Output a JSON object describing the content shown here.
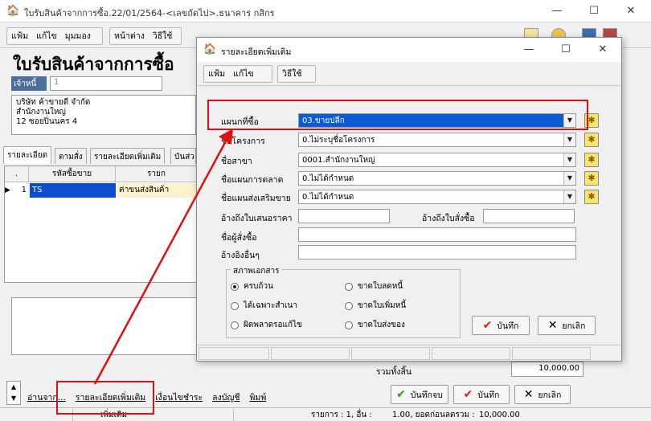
{
  "main_window": {
    "title": "ใบรับสินค้าจากการซื้อ.22/01/2564-<เลขถัดไป>.ธนาคาร กสิกร",
    "menu_left": [
      "แฟ้ม",
      "แก้ไข",
      "มุมมอง"
    ],
    "menu_right": [
      "หน้าต่าง",
      "วิธีใช้"
    ],
    "page_title": "ใบรับสินค้าจากการซื้อ",
    "vendor_label": "เจ้าหนี้",
    "vendor_code": "1",
    "vendor_address": [
      "บริษัท ค้าขายดี จำกัด",
      "สำนักงานใหญ่",
      "12 ซอยปิ่นนคร 4"
    ],
    "tabs": [
      "รายละเอียด",
      "ตามสั่ง",
      "รายละเอียดเพิ่มเติม",
      "บันส่ว"
    ],
    "grid": {
      "headers": [
        ".",
        "รหัสซื้อขาย",
        "รายก"
      ],
      "row": {
        "no": "1",
        "code": "TS",
        "desc": "ค่าขนส่งสินค้า"
      }
    },
    "grand_total_label": "รวมทั้งสิ้น",
    "grand_total_value": "10,000.00",
    "bottom_links": [
      "อ่านจาก...",
      "รายละเอียดเพิ่มเติม",
      "เงื่อนไขชำระ",
      "ลงบัญชี",
      "พิมพ์"
    ],
    "buttons": {
      "save_close": "บันทึกจบ",
      "save": "บันทึก",
      "cancel": "ยกเลิก"
    },
    "status_bar": {
      "mode": "เพิ่มเติม",
      "items": "รายการ : 1, อื่น :",
      "amount": "1.00, ยอดก่อนลดรวม :",
      "total": "10,000.00"
    }
  },
  "dialog": {
    "title": "รายละเอียดเพิ่มเติม",
    "menu": [
      "แฟ้ม",
      "แก้ไข"
    ],
    "menu_right": "วิธีใช้",
    "fields": {
      "department": {
        "label": "แผนกที่ซื้อ",
        "value": "03.ขายปลีก"
      },
      "project": {
        "label": "ชื่อโครงการ",
        "value": "0.ไม่ระบุชื่อโครงการ"
      },
      "branch": {
        "label": "ชื่อสาขา",
        "value": "0001.สำนักงานใหญ่"
      },
      "marketing_plan": {
        "label": "ชื่อแผนการตลาด",
        "value": "0.ไม่ได้กำหนด"
      },
      "promotion_plan": {
        "label": "ชื่อแผนส่งเสริมขาย",
        "value": "0.ไม่ได้กำหนด"
      },
      "quotation_ref": {
        "label": "อ้างถึงใบเสนอราคา",
        "value": ""
      },
      "po_ref": {
        "label": "อ้างถึงใบสั่งซื้อ",
        "value": ""
      },
      "buyer": {
        "label": "ชื่อผู้สั่งซื้อ",
        "value": ""
      },
      "other_ref": {
        "label": "อ้างอิงอื่นๆ",
        "value": ""
      }
    },
    "doc_status": {
      "title": "สภาพเอกสาร",
      "options": [
        "ครบถ้วน",
        "ได้เฉพาะสำเนา",
        "ผิดพลาดรอแก้ไข",
        "ขาดใบลดหนี้",
        "ขาดใบเพิ่มหนี้",
        "ขาดใบส่งของ"
      ],
      "selected": "ครบถ้วน"
    },
    "buttons": {
      "save": "บันทึก",
      "cancel": "ยกเลิก"
    }
  },
  "annotation_color": "#e01010"
}
